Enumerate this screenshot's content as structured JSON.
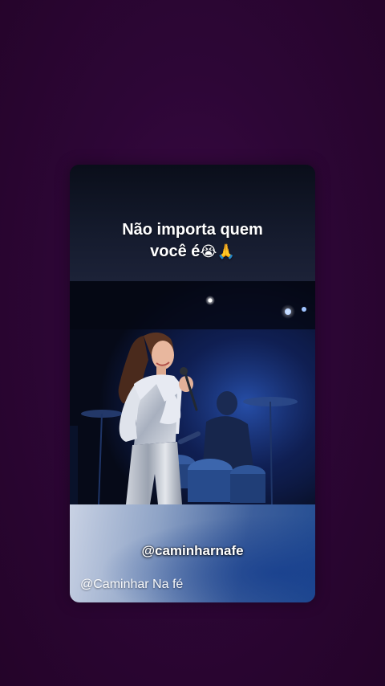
{
  "story": {
    "caption_line1": "Não importa quem",
    "caption_line2": "você é",
    "caption_emojis": "😭🙏",
    "handle": "@caminharnafe",
    "watermark": "@Caminhar Na fé"
  },
  "colors": {
    "background": "#2c0634",
    "caption_background": "#141a2c",
    "stage_blue": "#1d3f8f",
    "bottom_gradient_light": "#c9d2e4",
    "bottom_gradient_dark": "#224c92"
  }
}
